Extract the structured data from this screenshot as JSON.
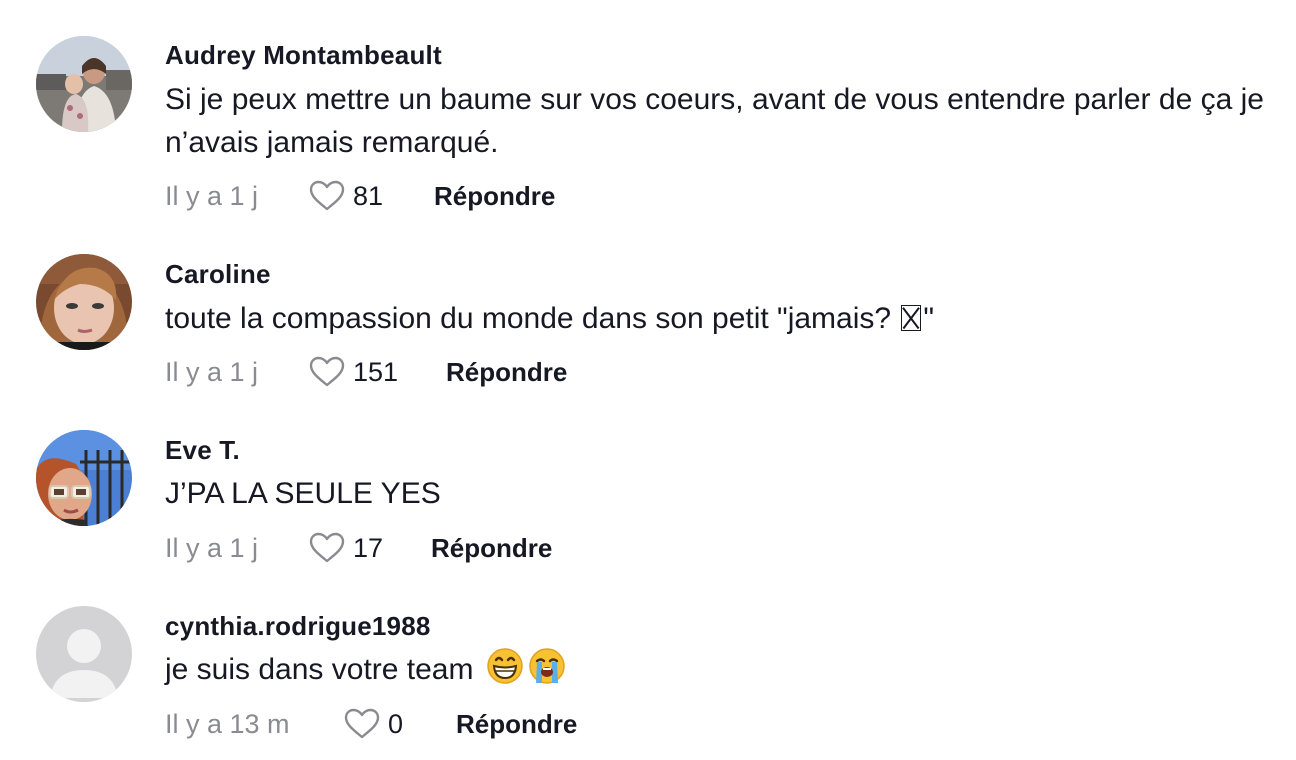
{
  "comments": [
    {
      "username": "Audrey Montambeault",
      "text": "Si je peux mettre un baume sur vos coeurs, avant de vous entendre parler de ça je n’avais jamais remarqué.",
      "time": "Il y a 1 j",
      "likes": "81",
      "reply_label": "Répondre",
      "avatar": "photo-woman-with-child"
    },
    {
      "username": "Caroline",
      "text": "toute la compassion du monde dans son petit \"jamais? ",
      "text_end": "\"",
      "time": "Il y a 1 j",
      "likes": "151",
      "reply_label": "Répondre",
      "avatar": "photo-woman-selfie"
    },
    {
      "username": "Eve T.",
      "text": "J’PA LA SEULE YES",
      "time": "Il y a 1 j",
      "likes": "17",
      "reply_label": "Répondre",
      "avatar": "photo-woman-sunglasses"
    },
    {
      "username": "cynthia.rodrigue1988",
      "text": "je suis dans votre team ",
      "emojis": [
        "grinning-face-icon",
        "loudly-crying-face-icon"
      ],
      "time": "Il y a 13 m",
      "likes": "0",
      "reply_label": "Répondre",
      "avatar": "default-avatar"
    }
  ],
  "colors": {
    "text_primary": "#161823",
    "text_secondary": "#8a8b91",
    "heart_outline": "#8a8b91",
    "default_avatar_bg": "#d3d3d5"
  }
}
